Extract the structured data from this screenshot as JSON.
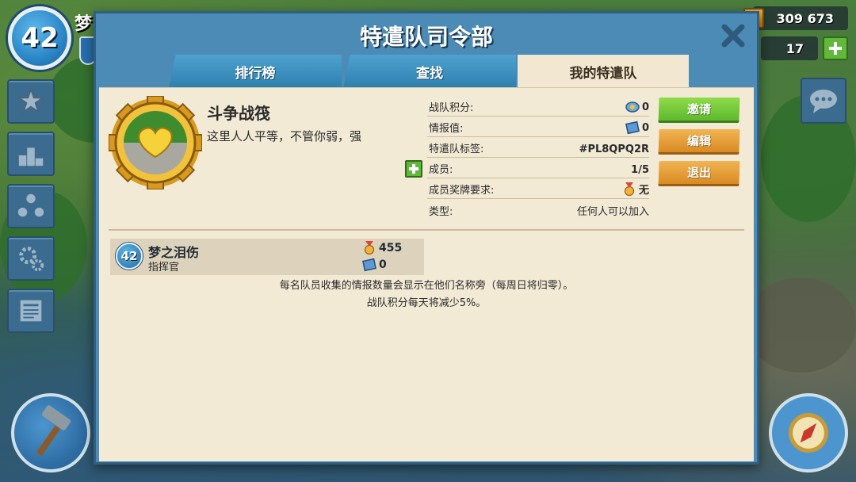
{
  "hud": {
    "player_level": "42",
    "player_name": "梦",
    "gold_amount": "309 673",
    "diamonds_amount": "17"
  },
  "modal": {
    "title": "特遣队司令部",
    "tabs": [
      {
        "label": "排行榜",
        "active": false
      },
      {
        "label": "查找",
        "active": false
      },
      {
        "label": "我的特遣队",
        "active": true
      }
    ]
  },
  "team": {
    "name": "斗争战筏",
    "description": "这里人人平等，不管你弱，强",
    "info": {
      "score_label": "战队积分:",
      "score_value": "0",
      "intel_label": "情报值:",
      "intel_value": "0",
      "tag_label": "特遣队标签:",
      "tag_value": "#PL8QPQ2R",
      "members_label": "成员:",
      "members_value": "1/5",
      "medal_req_label": "成员奖牌要求:",
      "medal_req_value": "无",
      "type_label": "类型:",
      "type_value": "任何人可以加入"
    },
    "actions": {
      "invite": "邀请",
      "edit": "编辑",
      "leave": "退出"
    }
  },
  "members": [
    {
      "level": "42",
      "name": "梦之泪伤",
      "role": "指挥官",
      "medals": "455",
      "intel": "0"
    }
  ],
  "notes": {
    "line1": "每名队员收集的情报数量会显示在他们名称旁（每周日将归零）。",
    "line2": "战队积分每天将减少5%。"
  },
  "colors": {
    "modal_blue": "#4b8bb5",
    "paper": "#f3ead6",
    "invite_green": "#6fc637",
    "orange_button": "#e39a34"
  }
}
